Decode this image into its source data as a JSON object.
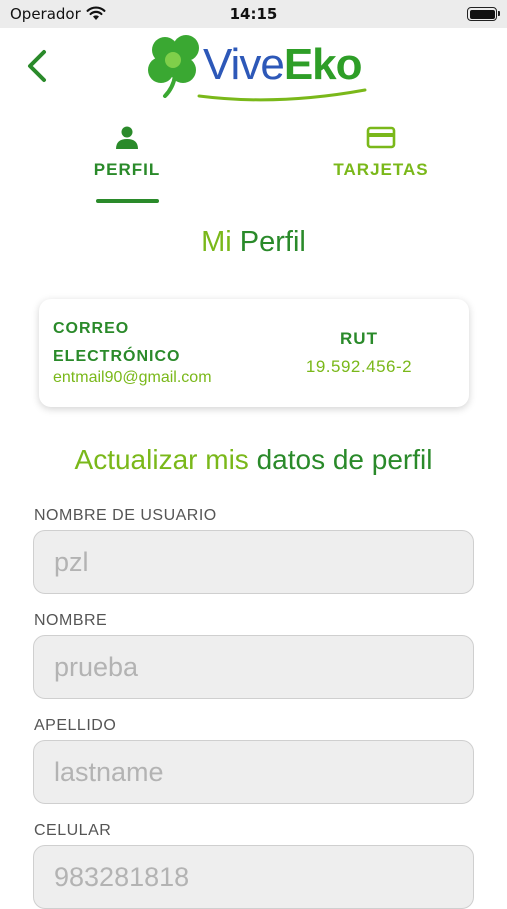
{
  "status_bar": {
    "carrier": "Operador",
    "time": "14:15"
  },
  "header": {
    "logo_part1": "Vive",
    "logo_part2": "Eko"
  },
  "tabs": [
    {
      "label": "PERFIL",
      "icon": "person-icon",
      "active": true
    },
    {
      "label": "TARJETAS",
      "icon": "credit-card-icon",
      "active": false
    }
  ],
  "profile": {
    "title_part1": "Mi",
    "title_part2": "Perfil",
    "email_label": "CORREO ELECTRÓNICO",
    "email_value": "entmail90@gmail.com",
    "rut_label": "RUT",
    "rut_value": "19.592.456-2"
  },
  "form": {
    "title_part1": "Actualizar mis",
    "title_part2": "datos de perfil",
    "fields": [
      {
        "label": "NOMBRE DE USUARIO",
        "placeholder": "pzl"
      },
      {
        "label": "NOMBRE",
        "placeholder": "prueba"
      },
      {
        "label": "APELLIDO",
        "placeholder": "lastname"
      },
      {
        "label": "CELULAR",
        "placeholder": "983281818"
      }
    ]
  },
  "colors": {
    "dark_green": "#2a8a2a",
    "light_green": "#7ab81a",
    "logo_blue": "#2d58b8"
  }
}
